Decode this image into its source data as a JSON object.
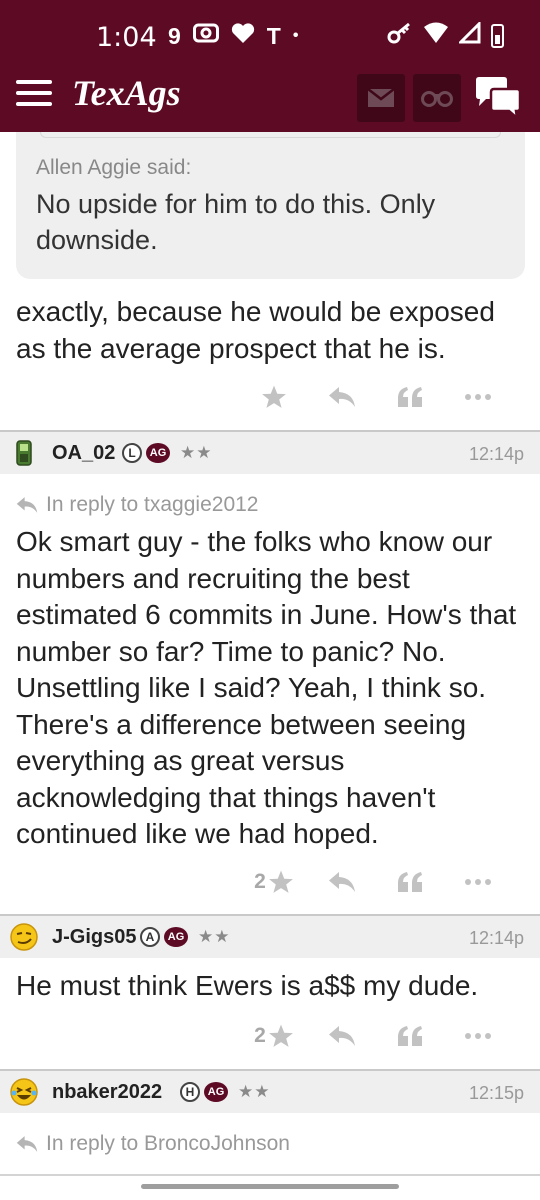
{
  "status": {
    "time": "1:04",
    "left_glyphs": [
      "9",
      "T",
      "•"
    ]
  },
  "header": {
    "logo": "TexAgs",
    "icons": [
      "menu-icon",
      "mail-icon",
      "binoculars-icon",
      "chat-bubbles-icon"
    ]
  },
  "colors": {
    "brand": "#5d0a25",
    "header_button": "#3f0718",
    "quote_bg": "#efefef"
  },
  "quote": {
    "said": "Allen Aggie said:",
    "text": "No upside for him to do this. Only downside."
  },
  "posts": [
    {
      "body": "exactly, because he would be exposed as the average prospect that he is.",
      "star_count": ""
    },
    {
      "username": "OA_02",
      "badge_letter": "L",
      "badge_ag": "AG",
      "stars": "★★",
      "time": "12:14p",
      "reply_to": "In reply to txaggie2012",
      "body": "Ok smart guy - the folks who know our numbers and recruiting the best estimated 6 commits in June. How's that number so far? Time to panic? No. Unsettling like I said? Yeah, I think so. There's a difference between seeing everything as great versus acknowledging that things haven't continued like we had hoped.",
      "star_count": "2"
    },
    {
      "username": "J-Gigs05",
      "badge_letter": "A",
      "badge_ag": "AG",
      "stars": "★★",
      "time": "12:14p",
      "body": "He must think Ewers is a$$ my dude.",
      "star_count": "2"
    },
    {
      "username": "nbaker2022",
      "badge_letter": "H",
      "badge_ag": "AG",
      "stars": "★★",
      "time": "12:15p",
      "reply_to": "In reply to BroncoJohnson"
    }
  ]
}
